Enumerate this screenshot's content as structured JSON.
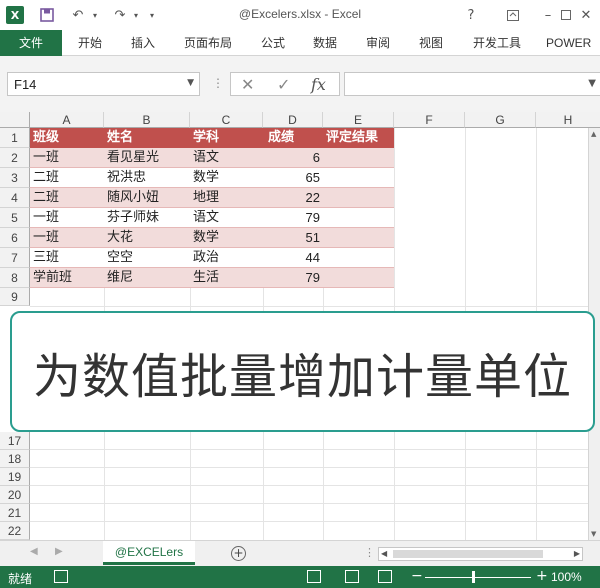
{
  "window": {
    "title": "@Excelers.xlsx - Excel",
    "logo_letter": "X",
    "help": "?",
    "minimize": "–",
    "close": "✕"
  },
  "ribbon": {
    "tabs": [
      "文件",
      "开始",
      "插入",
      "页面布局",
      "公式",
      "数据",
      "审阅",
      "视图",
      "开发工具",
      "POWER"
    ]
  },
  "formula_bar": {
    "name_box": "F14",
    "cancel": "✕",
    "enter": "✓",
    "fx": "fx",
    "formula": ""
  },
  "columns": [
    "A",
    "B",
    "C",
    "D",
    "E",
    "F",
    "G",
    "H"
  ],
  "rows": [
    "1",
    "2",
    "3",
    "4",
    "5",
    "6",
    "7",
    "8",
    "9",
    "17",
    "18",
    "19",
    "20",
    "21",
    "22"
  ],
  "table": {
    "headers": [
      "班级",
      "姓名",
      "学科",
      "成绩",
      "评定结果"
    ],
    "rows": [
      [
        "一班",
        "看见星光",
        "语文",
        "6",
        ""
      ],
      [
        "二班",
        "祝洪忠",
        "数学",
        "65",
        ""
      ],
      [
        "二班",
        "随风小妞",
        "地理",
        "22",
        ""
      ],
      [
        "一班",
        "芬子师妹",
        "语文",
        "79",
        ""
      ],
      [
        "一班",
        "大花",
        "数学",
        "51",
        ""
      ],
      [
        "三班",
        "空空",
        "政治",
        "44",
        ""
      ],
      [
        "学前班",
        "维尼",
        "生活",
        "79",
        ""
      ]
    ]
  },
  "overlay": {
    "text": "为数值批量增加计量单位"
  },
  "sheets": {
    "active": "@EXCELers",
    "add": "+"
  },
  "status": {
    "ready": "就绪",
    "zoom": "100%",
    "minus": "−",
    "plus": "+"
  },
  "colors": {
    "excel_green": "#217346",
    "header_red": "#c0504d",
    "band_pink": "#f2dcdb",
    "overlay_border": "#2a9d8f"
  }
}
